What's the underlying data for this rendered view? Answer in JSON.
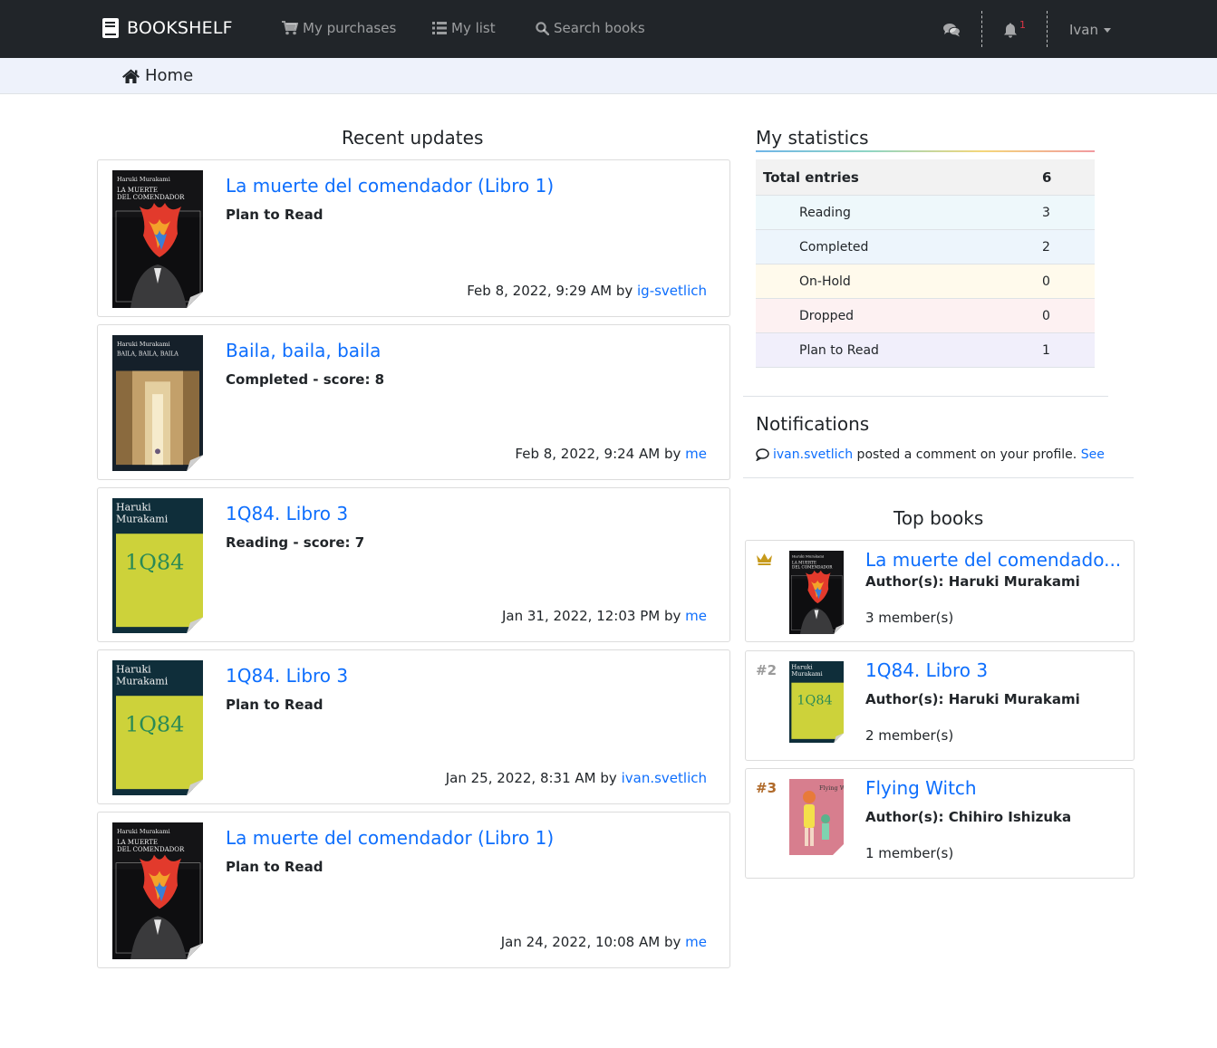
{
  "navbar": {
    "brand": "BOOKSHELF",
    "links": [
      {
        "label": "My purchases",
        "icon": "cart-icon"
      },
      {
        "label": "My list",
        "icon": "list-icon"
      },
      {
        "label": "Search books",
        "icon": "search-icon"
      }
    ],
    "notification_count": "1",
    "user": "Ivan"
  },
  "breadcrumb": {
    "label": "Home"
  },
  "recent": {
    "title": "Recent updates",
    "items": [
      {
        "title": "La muerte del comendador (Libro 1)",
        "status": "Plan to Read",
        "date": "Feb 8, 2022, 9:29 AM",
        "by": "by",
        "user": "ig-svetlich",
        "cover": "muerte"
      },
      {
        "title": "Baila, baila, baila",
        "status": "Completed - score: 8",
        "date": "Feb 8, 2022, 9:24 AM",
        "by": "by",
        "user": "me",
        "cover": "baila"
      },
      {
        "title": "1Q84. Libro 3",
        "status": "Reading - score: 7",
        "date": "Jan 31, 2022, 12:03 PM",
        "by": "by",
        "user": "me",
        "cover": "1q84"
      },
      {
        "title": "1Q84. Libro 3",
        "status": "Plan to Read",
        "date": "Jan 25, 2022, 8:31 AM",
        "by": "by",
        "user": "ivan.svetlich",
        "cover": "1q84"
      },
      {
        "title": "La muerte del comendador (Libro 1)",
        "status": "Plan to Read",
        "date": "Jan 24, 2022, 10:08 AM",
        "by": "by",
        "user": "me",
        "cover": "muerte"
      }
    ]
  },
  "stats": {
    "title": "My statistics",
    "total_label": "Total entries",
    "total_value": "6",
    "rows": [
      {
        "label": "Reading",
        "value": "3",
        "color": "#eef8fb"
      },
      {
        "label": "Completed",
        "value": "2",
        "color": "#edf5fc"
      },
      {
        "label": "On-Hold",
        "value": "0",
        "color": "#fffaec"
      },
      {
        "label": "Dropped",
        "value": "0",
        "color": "#fdf1f2"
      },
      {
        "label": "Plan to Read",
        "value": "1",
        "color": "#f1effb"
      }
    ]
  },
  "notifications": {
    "title": "Notifications",
    "user": "ivan.svetlich",
    "text": " posted a comment on your profile. ",
    "link": "See"
  },
  "top_books": {
    "title": "Top books",
    "items": [
      {
        "rank": "",
        "title": "La muerte del comendado...",
        "author": "Author(s): Haruki Murakami",
        "members": "3 member(s)",
        "cover": "muerte"
      },
      {
        "rank": "#2",
        "title": "1Q84. Libro 3",
        "author": "Author(s): Haruki Murakami",
        "members": "2 member(s)",
        "cover": "1q84"
      },
      {
        "rank": "#3",
        "title": "Flying Witch",
        "author": "Author(s): Chihiro Ishizuka",
        "members": "1 member(s)",
        "cover": "witch"
      }
    ]
  },
  "cover_text": {
    "author_line": "Haruki Murakami",
    "author_first": "Haruki",
    "author_last": "Murakami",
    "muerte_l1": "LA MUERTE",
    "muerte_l2": "DEL COMENDADOR",
    "baila": "BAILA, BAILA, BAILA",
    "q84": "1Q84",
    "witch": "Flying Witch"
  }
}
